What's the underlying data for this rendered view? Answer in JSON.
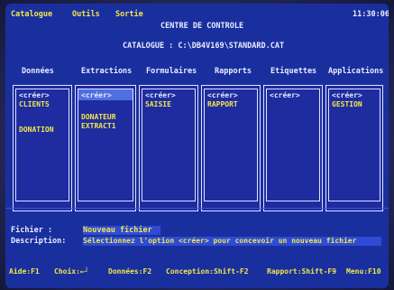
{
  "menu": {
    "catalogue": "Catalogue",
    "outils": "Outils",
    "sortie": "Sortie"
  },
  "clock": "11:30:06",
  "title": "CENTRE DE CONTROLE",
  "catalog_line": "CATALOGUE :  C:\\DB4V169\\STANDARD.CAT",
  "columns": [
    {
      "header": "Données",
      "create": "<créer>",
      "items": [
        "CLIENTS",
        "DONATION"
      ]
    },
    {
      "header": "Extractions",
      "create": "<créer>",
      "items": [
        "DONATEUR",
        "EXTRACT1"
      ]
    },
    {
      "header": "Formulaires",
      "create": "<créer>",
      "items": [
        "SAISIE"
      ]
    },
    {
      "header": "Rapports",
      "create": "<créer>",
      "items": [
        "RAPPORT"
      ]
    },
    {
      "header": "Etiquettes",
      "create": "<créer>",
      "items": []
    },
    {
      "header": "Applications",
      "create": "<créer>",
      "items": [
        "GESTION"
      ]
    }
  ],
  "info": {
    "fichier_label": "Fichier :",
    "fichier_value": "Nouveau fichier",
    "desc_label": "Description:",
    "desc_value": "Sélectionnez l'option <créer> pour concevoir un nouveau fichier"
  },
  "status": {
    "aide": "Aide:F1",
    "choix": "Choix:←┘",
    "donnees": "Données:F2",
    "conception": "Conception:Shift-F2",
    "rapport": "Rapport:Shift-F9",
    "menu": "Menu:F10"
  },
  "colors": {
    "screen": "#1a2f9e",
    "text_yellow": "#f2e64a",
    "text_white": "#e9ecff",
    "highlight": "#4f6fe0"
  }
}
